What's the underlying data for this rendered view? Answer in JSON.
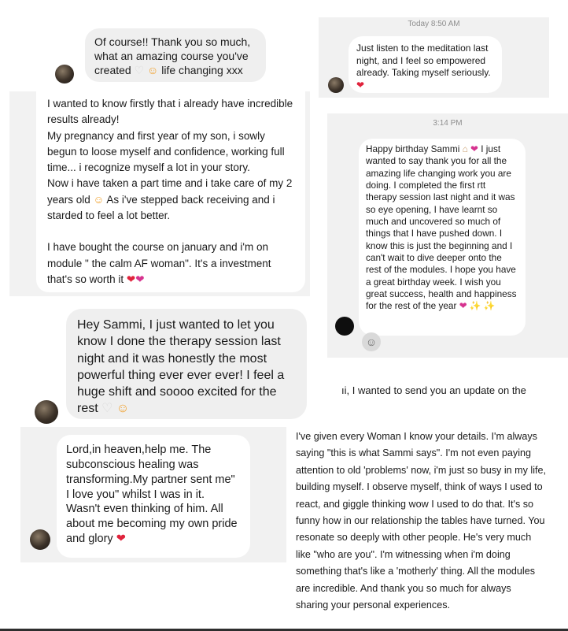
{
  "screens": {
    "top_left": {
      "message": "Of course!! Thank you so much, what an amazing course you've created",
      "tail": "life changing xxx",
      "emoji_heart": "♡",
      "emoji_face": "☺"
    },
    "top_right": {
      "timestamp": "Today 8:50 AM",
      "message": "Just listen to the meditation last night, and I feel so empowered already. Taking myself seriously.",
      "emoji_heart": "❤"
    },
    "middle_left": {
      "message": "I wanted to know firstly that i already have incredible results already!\nMy pregnancy and first year of my son, i sowly begun to loose myself and confidence, working full time... i recognize myself a lot in your story.\nNow i have taken a part time and i take care of my 2 years old",
      "message_tail": "As i've stepped back receiving and i starded to feel a lot better.\n\nI have bought the course on january and i'm on module \" the calm AF woman\". It's a investment that's so worth it",
      "emoji_face": "☺",
      "emoji_heart_red": "❤",
      "emoji_heart_pink": "❤"
    },
    "middle_right": {
      "timestamp": "3:14 PM",
      "message_head": "Happy birthday Sammi",
      "message": "I just wanted to say thank you for all the amazing life changing work you are doing. I completed the first rtt therapy session last night and it was so eye opening, I have learnt so much and uncovered so much of things that I have pushed down. I know this is just the beginning and I can't wait to dive deeper onto the rest of the modules. I hope you have a great birthday week. I wish you great success, health and happiness for the rest of the year",
      "emoji_cake": "⌂",
      "emoji_heart": "❤",
      "emoji_sparkles": "✨ ✨",
      "reaction_icon": "☺"
    },
    "hey_sammi": {
      "message": "Hey Sammi, I just wanted to let you know I done the therapy session last night and it was honestly the most powerful thing ever ever ever! I feel a huge shift and soooo excited for the rest",
      "emoji_heart": "♡",
      "emoji_face": "☺"
    },
    "update_snippet": {
      "text": "ıi, I wanted to send you an update on the"
    },
    "lord_heaven": {
      "message": "Lord,in heaven,help me. The subconscious healing was transforming.My partner sent me\" I love you\" whilst I was in it. Wasn't even thinking of him. All about me becoming my own pride and glory",
      "emoji_heart": "❤"
    },
    "long_note": {
      "text": "I've given every Woman I know your details. I'm always saying \"this is what Sammi says\". I'm not even paying attention to old 'problems' now, i'm just so busy in my life, building myself. I observe myself, think of ways I used to react, and giggle thinking wow I used to do that. It's so funny how in our relationship the tables have turned. You resonate so deeply with other people. He's very much like \"who are you\". I'm witnessing when i'm doing something that's like a 'motherly' thing. All the modules are incredible. And thank you so much for always sharing your personal experiences."
    }
  },
  "colors": {
    "screen_bg": "#f1f1f1",
    "bubble_gray": "#efefef",
    "bubble_white": "#ffffff",
    "heart_red": "#e0233c",
    "heart_pink": "#d6338f"
  }
}
